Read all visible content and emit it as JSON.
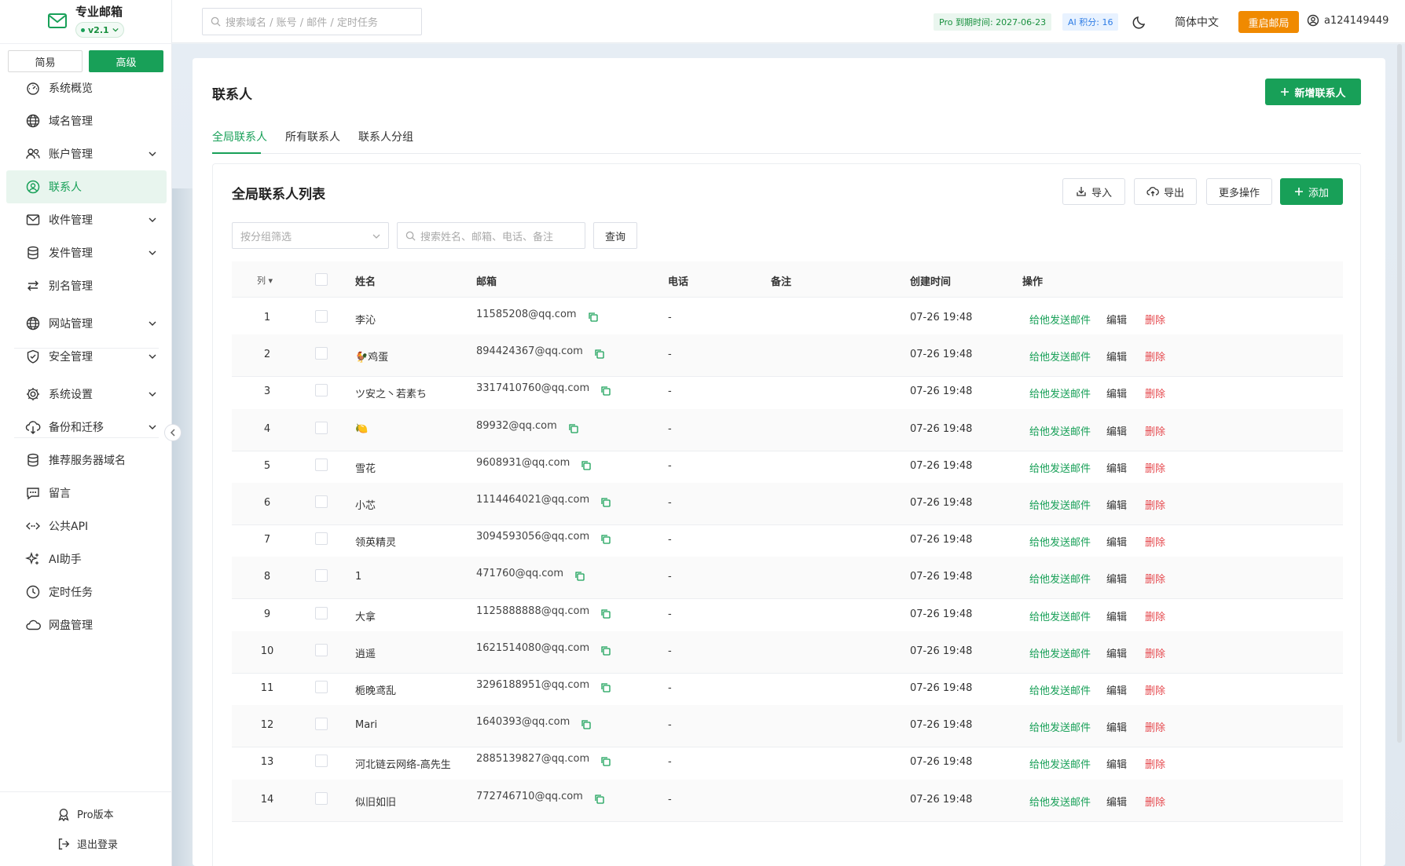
{
  "app": {
    "name": "专业邮箱",
    "version": "v2.1"
  },
  "mode": {
    "simple": "简易",
    "advanced": "高级"
  },
  "sidebar": {
    "items": [
      {
        "label": "系统概览",
        "icon": "dashboard-icon",
        "expandable": false,
        "active": false
      },
      {
        "label": "域名管理",
        "icon": "globe-icon",
        "expandable": false,
        "active": false
      },
      {
        "label": "账户管理",
        "icon": "users-icon",
        "expandable": true,
        "active": false
      },
      {
        "label": "联系人",
        "icon": "contact-icon",
        "expandable": false,
        "active": true
      },
      {
        "label": "收件管理",
        "icon": "inbox-mail-icon",
        "expandable": true,
        "active": false
      },
      {
        "label": "发件管理",
        "icon": "database-icon",
        "expandable": true,
        "active": false
      },
      {
        "label": "别名管理",
        "icon": "swap-arrows-icon",
        "expandable": false,
        "active": false
      },
      {
        "label": "网站管理",
        "icon": "globe-icon",
        "expandable": true,
        "active": false
      },
      {
        "label": "安全管理",
        "icon": "shield-check-icon",
        "expandable": true,
        "active": false
      },
      {
        "label": "系统设置",
        "icon": "gear-icon",
        "expandable": true,
        "active": false
      },
      {
        "label": "备份和迁移",
        "icon": "cloud-download-icon",
        "expandable": true,
        "active": false
      },
      {
        "label": "推荐服务器域名",
        "icon": "database-icon",
        "expandable": false,
        "active": false
      },
      {
        "label": "留言",
        "icon": "message-icon",
        "expandable": false,
        "active": false
      },
      {
        "label": "公共API",
        "icon": "code-icon",
        "expandable": false,
        "active": false
      },
      {
        "label": "AI助手",
        "icon": "sparkles-icon",
        "expandable": false,
        "active": false
      },
      {
        "label": "定时任务",
        "icon": "clock-icon",
        "expandable": false,
        "active": false
      },
      {
        "label": "网盘管理",
        "icon": "cloud-icon",
        "expandable": false,
        "active": false
      }
    ],
    "footer": {
      "pro": "Pro版本",
      "logout": "退出登录"
    }
  },
  "header": {
    "search_placeholder": "搜索域名 / 账号 / 邮件 / 定时任务",
    "pro_expiry": "Pro 到期时间: 2027-06-23",
    "ai_points": "AI 积分: 16",
    "language": "简体中文",
    "restart_button": "重启邮局",
    "username": "a124149449"
  },
  "page": {
    "title": "联系人",
    "new_button": "新增联系人",
    "tabs": [
      "全局联系人",
      "所有联系人",
      "联系人分组"
    ],
    "active_tab": 0
  },
  "panel": {
    "title": "全局联系人列表",
    "buttons": {
      "import": "导入",
      "export": "导出",
      "more": "更多操作",
      "add": "添加"
    },
    "group_filter_placeholder": "按分组筛选",
    "search_placeholder": "搜索姓名、邮箱、电话、备注",
    "query_button": "查询"
  },
  "table": {
    "columns": {
      "seq": "列",
      "name": "姓名",
      "email": "邮箱",
      "phone": "电话",
      "remark": "备注",
      "created": "创建时间",
      "actions": "操作"
    },
    "action_labels": {
      "send": "给他发送邮件",
      "edit": "编辑",
      "delete": "删除"
    },
    "rows": [
      {
        "idx": "1",
        "name": "李沁",
        "email": "11585208@qq.com",
        "phone": "-",
        "remark": "",
        "created": "07-26 19:48"
      },
      {
        "idx": "2",
        "name": "🐓鸡蛋",
        "email": "894424367@qq.com",
        "phone": "-",
        "remark": "",
        "created": "07-26 19:48"
      },
      {
        "idx": "3",
        "name": "ツ安之丶若素ち",
        "email": "3317410760@qq.com",
        "phone": "-",
        "remark": "",
        "created": "07-26 19:48"
      },
      {
        "idx": "4",
        "name": "🍋",
        "email": "89932@qq.com",
        "phone": "-",
        "remark": "",
        "created": "07-26 19:48"
      },
      {
        "idx": "5",
        "name": "雪花",
        "email": "9608931@qq.com",
        "phone": "-",
        "remark": "",
        "created": "07-26 19:48"
      },
      {
        "idx": "6",
        "name": "小芯",
        "email": "1114464021@qq.com",
        "phone": "-",
        "remark": "",
        "created": "07-26 19:48"
      },
      {
        "idx": "7",
        "name": "领英精灵",
        "email": "3094593056@qq.com",
        "phone": "-",
        "remark": "",
        "created": "07-26 19:48"
      },
      {
        "idx": "8",
        "name": "1",
        "email": "471760@qq.com",
        "phone": "-",
        "remark": "",
        "created": "07-26 19:48"
      },
      {
        "idx": "9",
        "name": "大拿",
        "email": "1125888888@qq.com",
        "phone": "-",
        "remark": "",
        "created": "07-26 19:48"
      },
      {
        "idx": "10",
        "name": "逍遥",
        "email": "1621514080@qq.com",
        "phone": "-",
        "remark": "",
        "created": "07-26 19:48"
      },
      {
        "idx": "11",
        "name": "栀晚鸢乱",
        "email": "3296188951@qq.com",
        "phone": "-",
        "remark": "",
        "created": "07-26 19:48"
      },
      {
        "idx": "12",
        "name": "Mari",
        "email": "1640393@qq.com",
        "phone": "-",
        "remark": "",
        "created": "07-26 19:48"
      },
      {
        "idx": "13",
        "name": "河北链云网络-高先生",
        "email": "2885139827@qq.com",
        "phone": "-",
        "remark": "",
        "created": "07-26 19:48"
      },
      {
        "idx": "14",
        "name": "似旧如旧",
        "email": "772746710@qq.com",
        "phone": "-",
        "remark": "",
        "created": "07-26 19:48"
      }
    ]
  },
  "colors": {
    "accent": "#18a058",
    "danger": "#e5484d",
    "warning": "#f08a00",
    "info": "#2c7be5"
  }
}
